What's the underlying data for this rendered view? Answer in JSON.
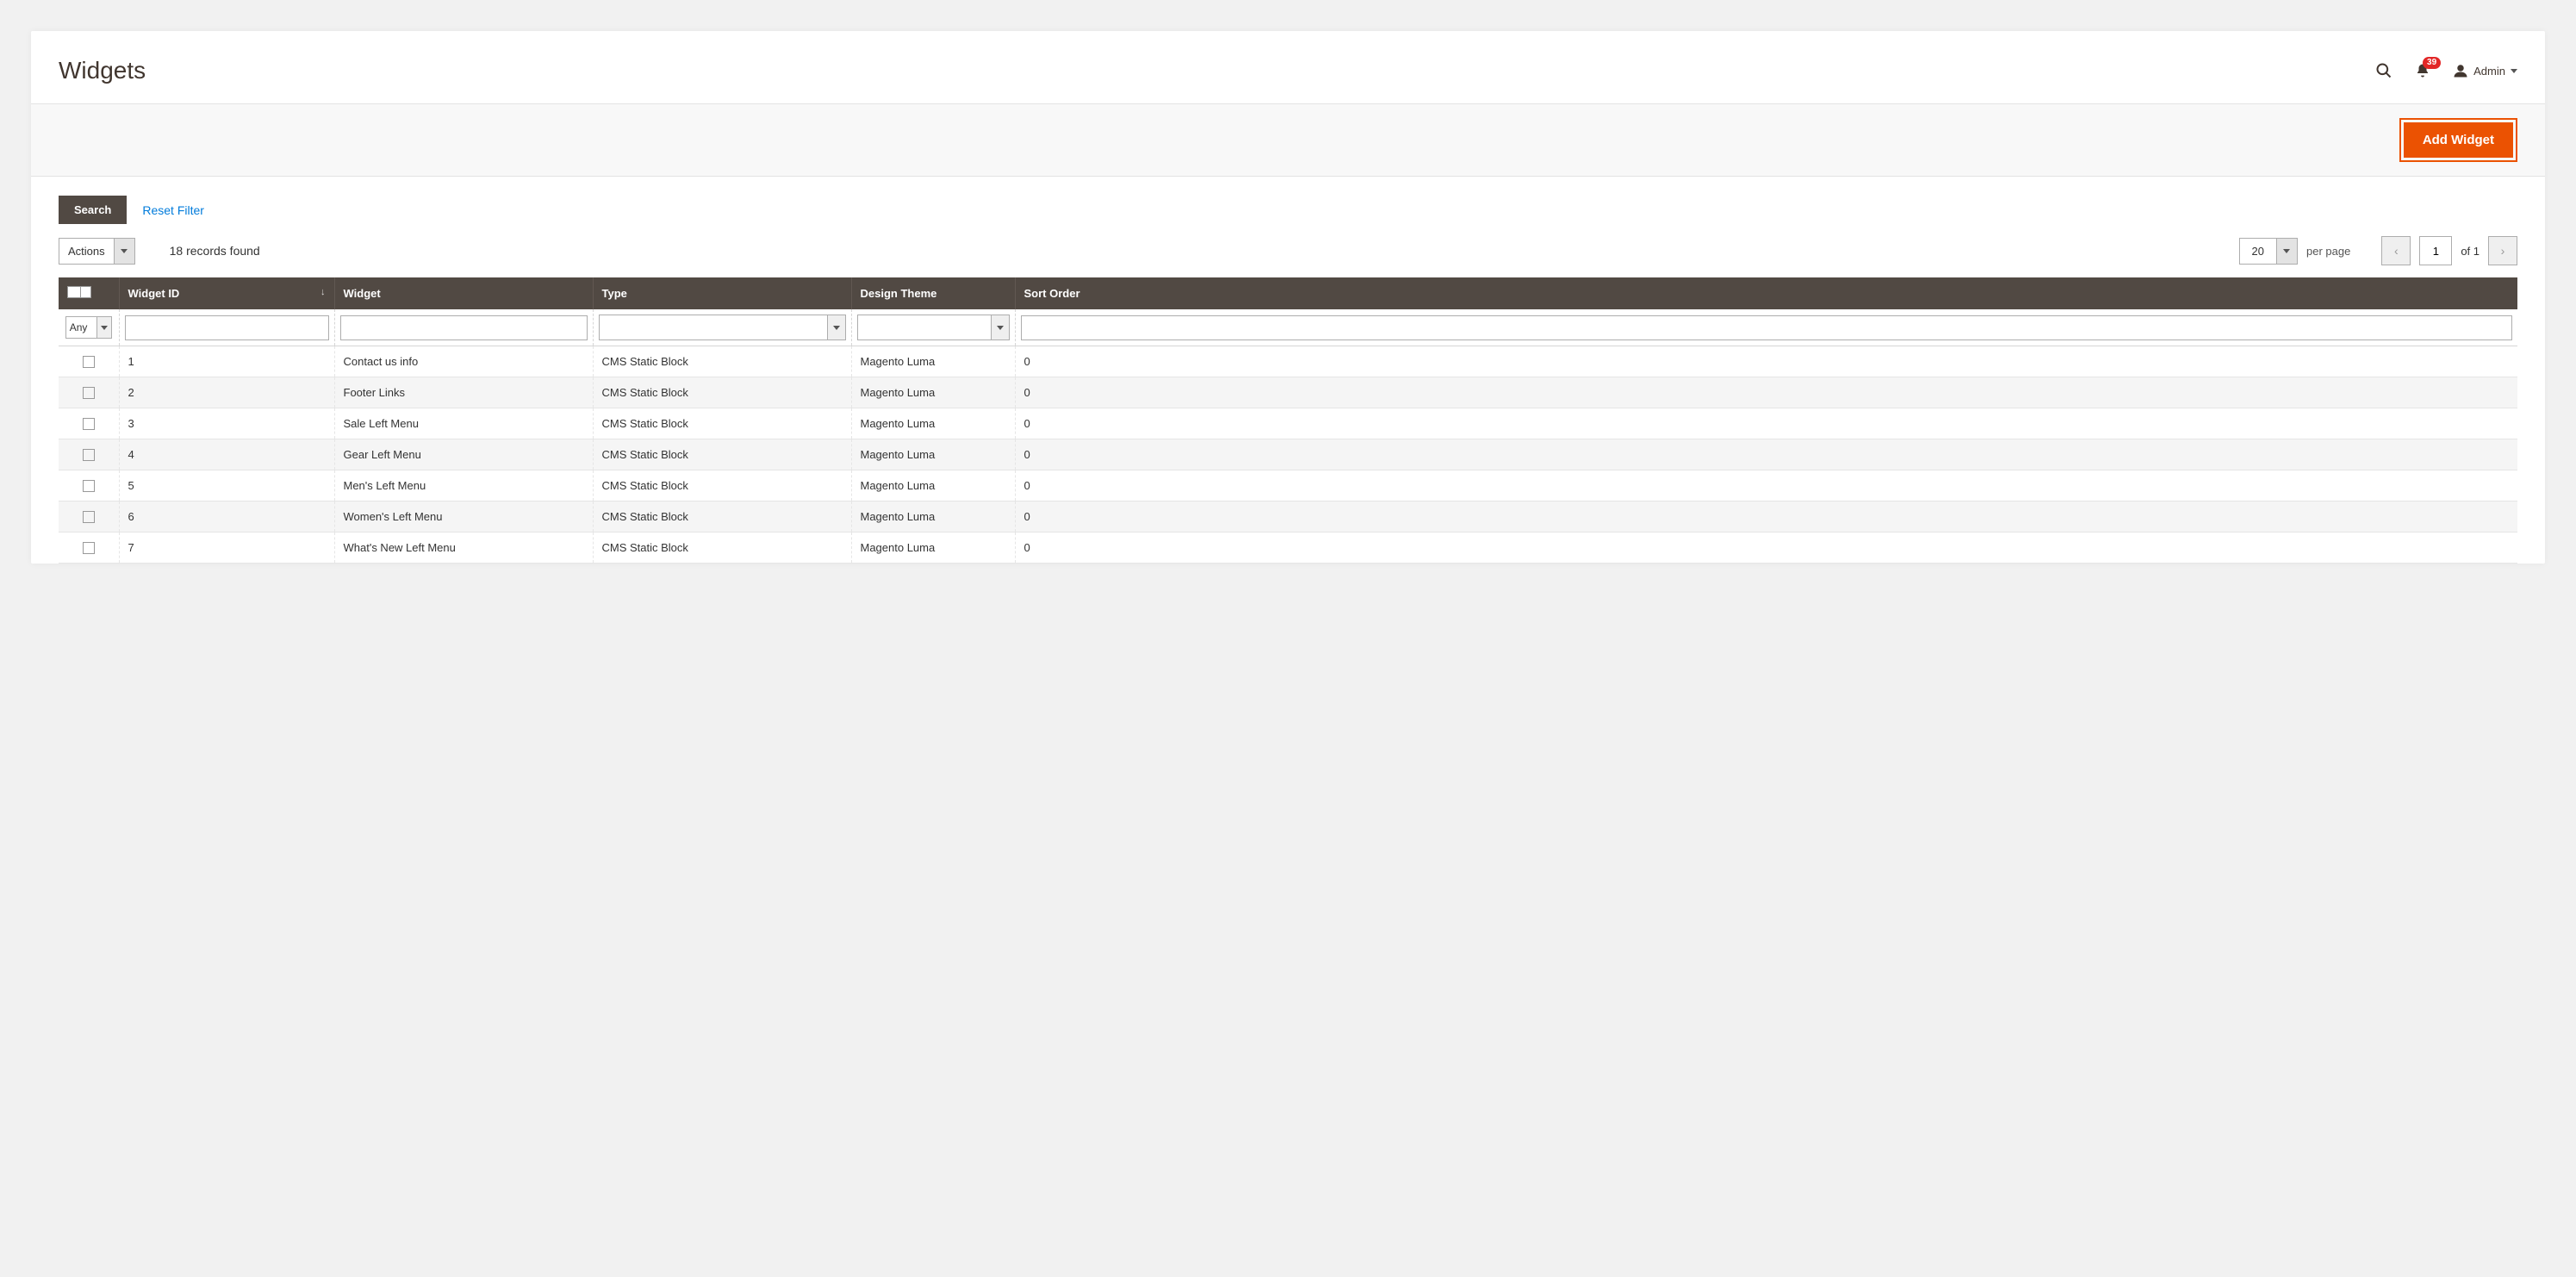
{
  "page_title": "Widgets",
  "notifications_count": "39",
  "user_name": "Admin",
  "add_button": "Add Widget",
  "search_button": "Search",
  "reset_filter": "Reset Filter",
  "actions_label": "Actions",
  "records_found": "18 records found",
  "per_page_value": "20",
  "per_page_label": "per page",
  "page_current": "1",
  "page_of": "of 1",
  "filter_any": "Any",
  "columns": {
    "widget_id": "Widget ID",
    "widget": "Widget",
    "type": "Type",
    "design_theme": "Design Theme",
    "sort_order": "Sort Order"
  },
  "rows": [
    {
      "id": "1",
      "widget": "Contact us info",
      "type": "CMS Static Block",
      "theme": "Magento Luma",
      "sort": "0"
    },
    {
      "id": "2",
      "widget": "Footer Links",
      "type": "CMS Static Block",
      "theme": "Magento Luma",
      "sort": "0"
    },
    {
      "id": "3",
      "widget": "Sale Left Menu",
      "type": "CMS Static Block",
      "theme": "Magento Luma",
      "sort": "0"
    },
    {
      "id": "4",
      "widget": "Gear Left Menu",
      "type": "CMS Static Block",
      "theme": "Magento Luma",
      "sort": "0"
    },
    {
      "id": "5",
      "widget": "Men's Left Menu",
      "type": "CMS Static Block",
      "theme": "Magento Luma",
      "sort": "0"
    },
    {
      "id": "6",
      "widget": "Women's Left Menu",
      "type": "CMS Static Block",
      "theme": "Magento Luma",
      "sort": "0"
    },
    {
      "id": "7",
      "widget": "What's New Left Menu",
      "type": "CMS Static Block",
      "theme": "Magento Luma",
      "sort": "0"
    }
  ]
}
